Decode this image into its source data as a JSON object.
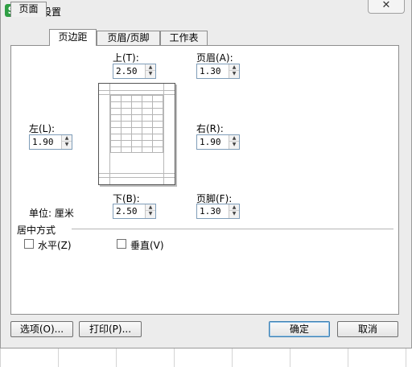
{
  "window": {
    "app_icon": "S",
    "title": "页面设置",
    "close_icon": "✕"
  },
  "tabs": [
    {
      "label": "页面",
      "active": false
    },
    {
      "label": "页边距",
      "active": true
    },
    {
      "label": "页眉/页脚",
      "active": false
    },
    {
      "label": "工作表",
      "active": false
    }
  ],
  "margins": {
    "top": {
      "label": "上(T):",
      "value": "2.50"
    },
    "header": {
      "label": "页眉(A):",
      "value": "1.30"
    },
    "left": {
      "label": "左(L):",
      "value": "1.90"
    },
    "right": {
      "label": "右(R):",
      "value": "1.90"
    },
    "bottom": {
      "label": "下(B):",
      "value": "2.50"
    },
    "footer": {
      "label": "页脚(F):",
      "value": "1.30"
    },
    "unit_label": "单位: 厘米"
  },
  "centering": {
    "heading": "居中方式",
    "horizontal": {
      "label": "水平(Z)",
      "checked": false
    },
    "vertical": {
      "label": "垂直(V)",
      "checked": false
    }
  },
  "buttons": {
    "options": "选项(O)...",
    "print": "打印(P)...",
    "ok": "确定",
    "cancel": "取消"
  }
}
